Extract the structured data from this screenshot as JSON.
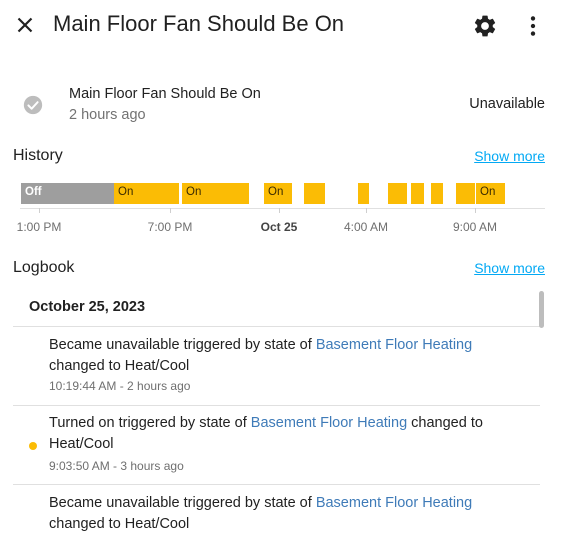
{
  "header": {
    "title": "Main Floor Fan Should Be On",
    "close_icon": "close-icon",
    "settings_icon": "gear-icon",
    "more_icon": "more-vert-icon"
  },
  "entity": {
    "name": "Main Floor Fan Should Be On",
    "last_changed": "2 hours ago",
    "state": "Unavailable",
    "icon": "check-circle-icon"
  },
  "history": {
    "title": "History",
    "show_more": "Show more",
    "segments": [
      {
        "label": "Off",
        "state": "off"
      },
      {
        "label": "On",
        "state": "on"
      },
      {
        "label": "On",
        "state": "on"
      },
      {
        "label": "On",
        "state": "on"
      },
      {
        "label": "",
        "state": "on"
      },
      {
        "label": "",
        "state": "on"
      },
      {
        "label": "",
        "state": "on"
      },
      {
        "label": "",
        "state": "on"
      },
      {
        "label": "",
        "state": "on"
      },
      {
        "label": "",
        "state": "on"
      },
      {
        "label": "On",
        "state": "on"
      }
    ],
    "ticks": [
      "1:00 PM",
      "7:00 PM",
      "Oct 25",
      "4:00 AM",
      "9:00 AM"
    ]
  },
  "logbook": {
    "title": "Logbook",
    "show_more": "Show more",
    "date": "October 25, 2023",
    "entries": [
      {
        "prefix": "Became unavailable triggered by state of ",
        "link": "Basement Floor Heating",
        "suffix": " changed to Heat/Cool",
        "time": "10:19:44 AM - 2 hours ago",
        "dot": false
      },
      {
        "prefix": "Turned on triggered by state of ",
        "link": "Basement Floor Heating",
        "suffix": " changed to Heat/Cool",
        "time": "9:03:50 AM - 3 hours ago",
        "dot": true
      },
      {
        "prefix": "Became unavailable triggered by state of ",
        "link": "Basement Floor Heating",
        "suffix": " changed to Heat/Cool",
        "time": "",
        "dot": false
      }
    ]
  },
  "colors": {
    "on": "#fbbc05",
    "off": "#9e9e9e",
    "link": "#3f7bb8",
    "accent": "#03a9f4"
  }
}
